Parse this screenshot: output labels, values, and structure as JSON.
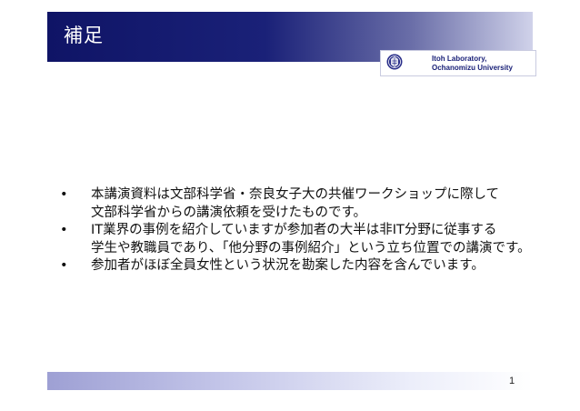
{
  "slide": {
    "title": "補足",
    "lab": {
      "line1": "Itoh Laboratory,",
      "line2": "Ochanomizu University"
    },
    "bullets": [
      {
        "lines": [
          "本講演資料は文部科学省・奈良女子大の共催ワークショップに際して",
          "文部科学省からの講演依頼を受けたものです。"
        ]
      },
      {
        "lines": [
          "IT業界の事例を紹介していますが参加者の大半は非IT分野に従事する",
          "学生や教職員であり、「他分野の事例紹介」という立ち位置での講演です。"
        ]
      },
      {
        "lines": [
          "参加者がほぼ全員女性という状況を勘案した内容を含んでいます。"
        ]
      }
    ],
    "bullet_symbol": "•",
    "page_number": "1"
  },
  "colors": {
    "title_bar": "#1a2178",
    "title_text": "#ffffff",
    "footer_bar": "#c2c4e8"
  },
  "icons": {
    "lab_logo": "university-crest-icon"
  }
}
